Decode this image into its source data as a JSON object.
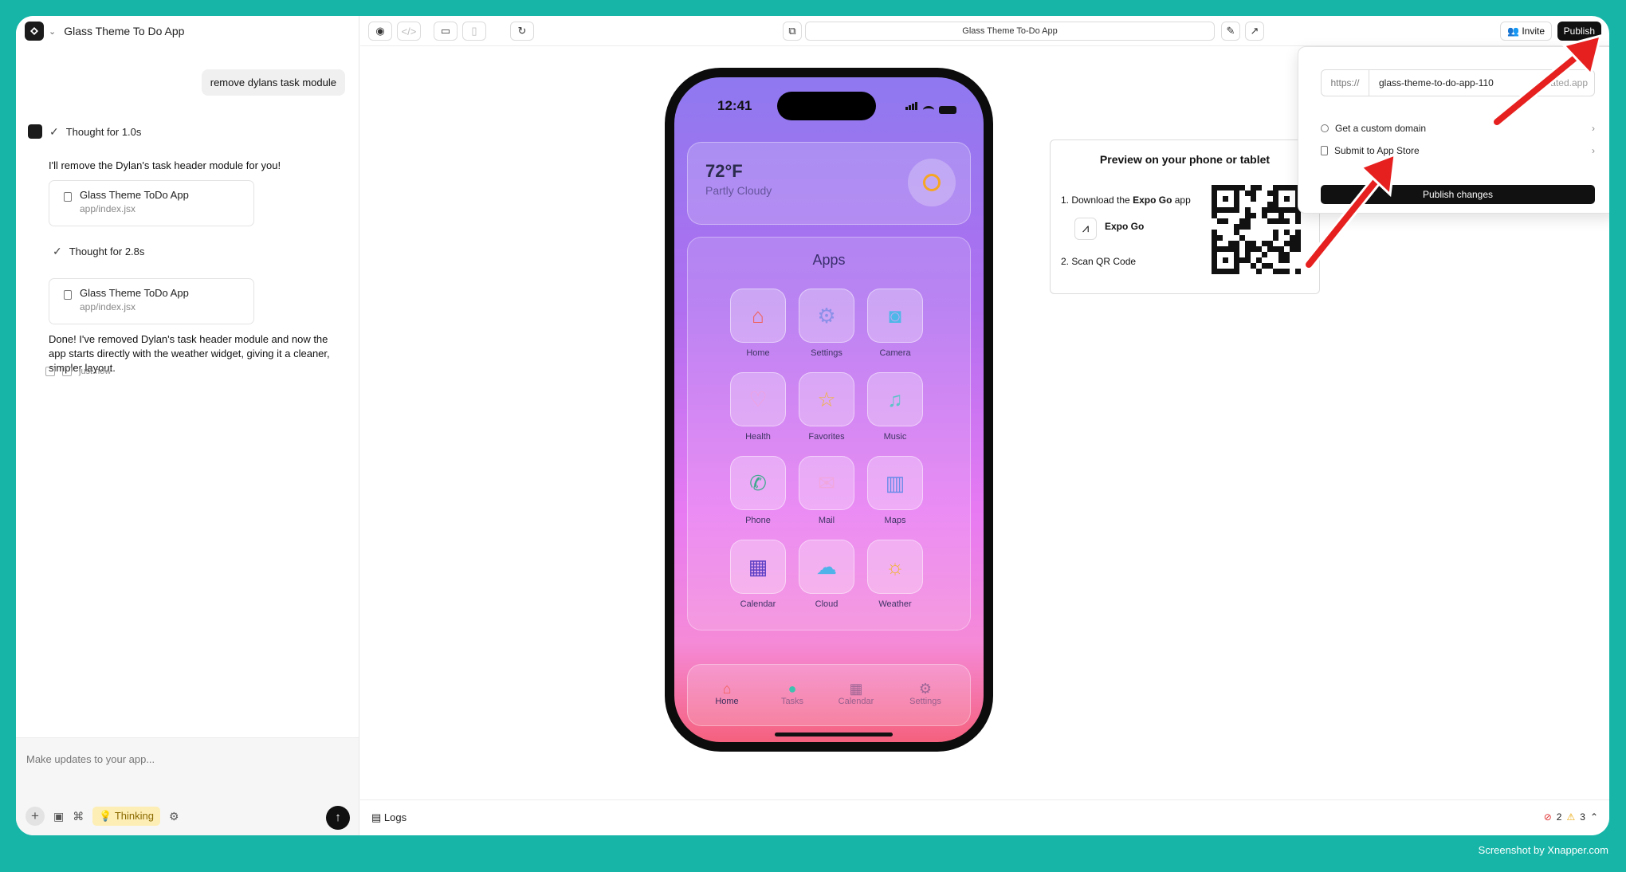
{
  "chat": {
    "project_title": "Glass Theme To Do App",
    "user_message": "remove dylans task module",
    "thought1": "Thought for 1.0s",
    "reply1": "I'll remove the Dylan's task header module for you!",
    "file1": {
      "title": "Glass Theme ToDo App",
      "path": "app/index.jsx"
    },
    "thought2": "Thought for 2.8s",
    "file2": {
      "title": "Glass Theme ToDo App",
      "path": "app/index.jsx"
    },
    "reply2": "Done! I've removed Dylan's task header module and now the app starts directly with the weather widget, giving it a cleaner, simpler layout.",
    "timestamp": "just now",
    "composer_placeholder": "Make updates to your app...",
    "thinking_label": "Thinking"
  },
  "toolbar": {
    "url_title": "Glass Theme To-Do App",
    "invite_label": "Invite",
    "publish_label": "Publish"
  },
  "phone": {
    "time": "12:41",
    "weather": {
      "temp": "72°F",
      "condition": "Partly Cloudy"
    },
    "apps_title": "Apps",
    "apps": [
      {
        "label": "Home",
        "icon": "home-icon",
        "glyph": "⌂",
        "color": "#f0615a"
      },
      {
        "label": "Settings",
        "icon": "gear-icon",
        "glyph": "⚙",
        "color": "#8b8fe8"
      },
      {
        "label": "Camera",
        "icon": "camera-icon",
        "glyph": "◙",
        "color": "#4fb7e8"
      },
      {
        "label": "Health",
        "icon": "heart-icon",
        "glyph": "♡",
        "color": "#f3a0d8"
      },
      {
        "label": "Favorites",
        "icon": "star-icon",
        "glyph": "☆",
        "color": "#f0b43a"
      },
      {
        "label": "Music",
        "icon": "music-icon",
        "glyph": "♫",
        "color": "#5fc2c9"
      },
      {
        "label": "Phone",
        "icon": "phone-icon",
        "glyph": "✆",
        "color": "#3fa98d"
      },
      {
        "label": "Mail",
        "icon": "mail-icon",
        "glyph": "✉",
        "color": "#f0a7de"
      },
      {
        "label": "Maps",
        "icon": "map-icon",
        "glyph": "▥",
        "color": "#6a8be8"
      },
      {
        "label": "Calendar",
        "icon": "calendar-icon",
        "glyph": "▦",
        "color": "#5b3fc4"
      },
      {
        "label": "Cloud",
        "icon": "cloud-icon",
        "glyph": "☁",
        "color": "#4fb2e8"
      },
      {
        "label": "Weather",
        "icon": "sun-icon",
        "glyph": "☼",
        "color": "#f0b43a"
      }
    ],
    "tabs": [
      {
        "label": "Home",
        "icon": "home-icon",
        "glyph": "⌂",
        "active": true
      },
      {
        "label": "Tasks",
        "icon": "tasks-icon",
        "glyph": "●",
        "active": false
      },
      {
        "label": "Calendar",
        "icon": "calendar-icon",
        "glyph": "▦",
        "active": false
      },
      {
        "label": "Settings",
        "icon": "gear-icon",
        "glyph": "⚙",
        "active": false
      }
    ]
  },
  "expo": {
    "title": "Preview on your phone or tablet",
    "step1_prefix": "1. Download the ",
    "step1_bold": "Expo Go",
    "step1_suffix": " app",
    "app_name": "Expo Go",
    "step2": "2. Scan QR Code"
  },
  "publish_menu": {
    "prefix": "https://",
    "slug": "glass-theme-to-do-app-110",
    "domain_suffix": "ated.app",
    "custom_domain": "Get a custom domain",
    "app_store": "Submit to App Store",
    "publish_changes": "Publish changes"
  },
  "bottom": {
    "logs_label": "Logs",
    "errors": "2",
    "warnings": "3"
  },
  "credit": "Screenshot by Xnapper.com",
  "colors": {
    "background": "#17b5a8",
    "accent": "#111111",
    "annotation_arrow": "#e5201f"
  }
}
